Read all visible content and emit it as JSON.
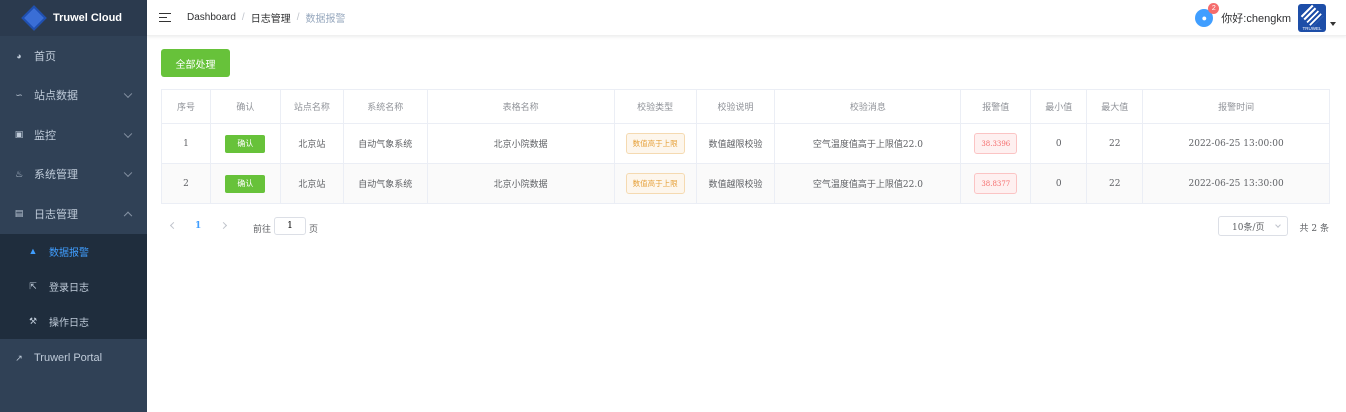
{
  "app": {
    "name": "Truwel Cloud"
  },
  "sidebar": {
    "items": [
      {
        "label": "首页",
        "icon": "dashboard-icon"
      },
      {
        "label": "站点数据",
        "icon": "chart-icon"
      },
      {
        "label": "监控",
        "icon": "monitor-icon"
      },
      {
        "label": "系统管理",
        "icon": "system-icon"
      },
      {
        "label": "日志管理",
        "icon": "log-icon"
      }
    ],
    "sub_items": [
      {
        "label": "数据报警",
        "icon": "warning-icon"
      },
      {
        "label": "登录日志",
        "icon": "login-icon"
      },
      {
        "label": "操作日志",
        "icon": "wrench-icon"
      }
    ],
    "portal": {
      "label": "Truwerl Portal",
      "icon": "external-link-icon"
    }
  },
  "header": {
    "breadcrumb": [
      "Dashboard",
      "日志管理",
      "数据报警"
    ],
    "separator": "/",
    "badge_count": "2",
    "greeting": "你好:chengkm",
    "avatar_text": "TRUWEL"
  },
  "main": {
    "process_all_label": "全部处理",
    "columns": [
      "序号",
      "确认",
      "站点名称",
      "系统名称",
      "表格名称",
      "校验类型",
      "校验说明",
      "校验消息",
      "报警值",
      "最小值",
      "最大值",
      "报警时间"
    ],
    "rows": [
      {
        "index": "1",
        "confirm": "确认",
        "station": "北京站",
        "system": "自动气象系统",
        "table": "北京小院数据",
        "check_type": "数值高于上限",
        "check_desc": "数值越限校验",
        "message": "空气温度值高于上限值22.0",
        "alarm_value": "38.3396",
        "min": "0",
        "max": "22",
        "time": "2022-06-25 13:00:00"
      },
      {
        "index": "2",
        "confirm": "确认",
        "station": "北京站",
        "system": "自动气象系统",
        "table": "北京小院数据",
        "check_type": "数值高于上限",
        "check_desc": "数值越限校验",
        "message": "空气温度值高于上限值22.0",
        "alarm_value": "38.8377",
        "min": "0",
        "max": "22",
        "time": "2022-06-25 13:30:00"
      }
    ]
  },
  "pagination": {
    "current_page": "1",
    "goto_prefix": "前往",
    "goto_value": "1",
    "goto_suffix": "页",
    "page_size": "10条/页",
    "total": "共 2 条"
  },
  "colors": {
    "sidebar_bg": "#304156",
    "submenu_bg": "#1f2d3d",
    "active": "#409eff",
    "success": "#67c23a",
    "warning": "#e6a23c",
    "danger": "#f56c6c"
  }
}
